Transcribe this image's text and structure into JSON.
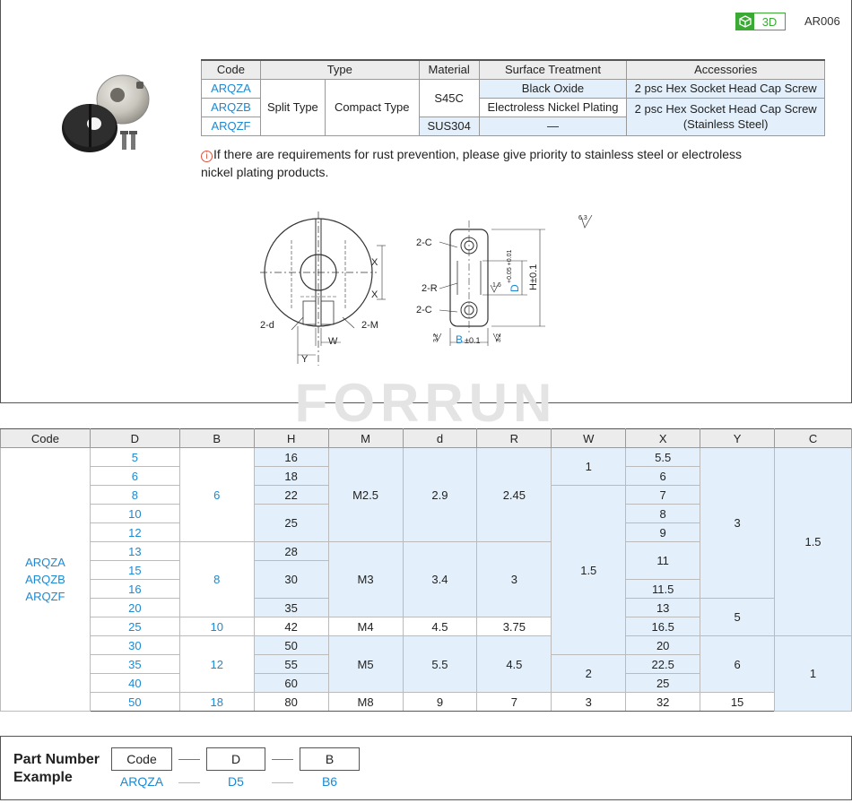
{
  "header": {
    "badge_label": "3D",
    "code": "AR006"
  },
  "spec_table": {
    "headers": [
      "Code",
      "Type",
      "Material",
      "Surface Treatment",
      "Accessories"
    ],
    "codes": [
      "ARQZA",
      "ARQZB",
      "ARQZF"
    ],
    "type_split": "Split Type",
    "type_compact": "Compact Type",
    "material_s45c": "S45C",
    "material_sus": "SUS304",
    "surface_black": "Black Oxide",
    "surface_nickel": "Electroless Nickel Plating",
    "surface_none": "—",
    "accessory_1": "2 psc Hex Socket Head Cap Screw",
    "accessory_2_line1": "2 psc Hex Socket Head Cap Screw",
    "accessory_2_line2": "(Stainless Steel)"
  },
  "note": {
    "icon": "i",
    "text": "If there are requirements for rust prevention, please give priority to stainless steel or electroless nickel plating products."
  },
  "drawing_labels": {
    "front_2d": "2-d",
    "front_2m": "2-M",
    "front_w": "W",
    "front_y": "Y",
    "front_x1": "X",
    "front_x2": "X",
    "side_2c_top": "2-C",
    "side_2r": "2-R",
    "side_2c_bot": "2-C",
    "side_h": "H±0.1",
    "side_d": "D",
    "side_d_tol": "+0.05 +0.01",
    "side_b": "B",
    "side_b_tol": "±0.1",
    "rough_63": "6.3",
    "rough_16": "1.6",
    "rough_32a": "3.2",
    "rough_32b": "3.2"
  },
  "watermark": "FORRUN",
  "dims_table": {
    "headers": [
      "Code",
      "D",
      "B",
      "H",
      "M",
      "d",
      "R",
      "W",
      "X",
      "Y",
      "C"
    ],
    "code_lines": [
      "ARQZA",
      "ARQZB",
      "ARQZF"
    ],
    "D": [
      "5",
      "6",
      "8",
      "10",
      "12",
      "13",
      "15",
      "16",
      "20",
      "25",
      "30",
      "35",
      "40",
      "50"
    ],
    "B": [
      "6",
      "8",
      "10",
      "12",
      "18"
    ],
    "H": [
      "16",
      "18",
      "22",
      "25",
      "28",
      "30",
      "35",
      "42",
      "50",
      "55",
      "60",
      "80"
    ],
    "M": [
      "M2.5",
      "M3",
      "M4",
      "M5",
      "M8"
    ],
    "d": [
      "2.9",
      "3.4",
      "4.5",
      "5.5",
      "9"
    ],
    "R": [
      "2.45",
      "3",
      "3.75",
      "4.5",
      "7"
    ],
    "W": [
      "1",
      "1.5",
      "2",
      "3"
    ],
    "X": [
      "5.5",
      "6",
      "7",
      "8",
      "9",
      "11",
      "11.5",
      "13",
      "16.5",
      "20",
      "22.5",
      "25",
      "32"
    ],
    "Y": [
      "3",
      "5",
      "6",
      "15"
    ],
    "C": [
      "1.5",
      "1"
    ]
  },
  "part_number": {
    "title_line1": "Part Number",
    "title_line2": "Example",
    "boxes": [
      "Code",
      "D",
      "B"
    ],
    "values": [
      "ARQZA",
      "D5",
      "B6"
    ]
  }
}
